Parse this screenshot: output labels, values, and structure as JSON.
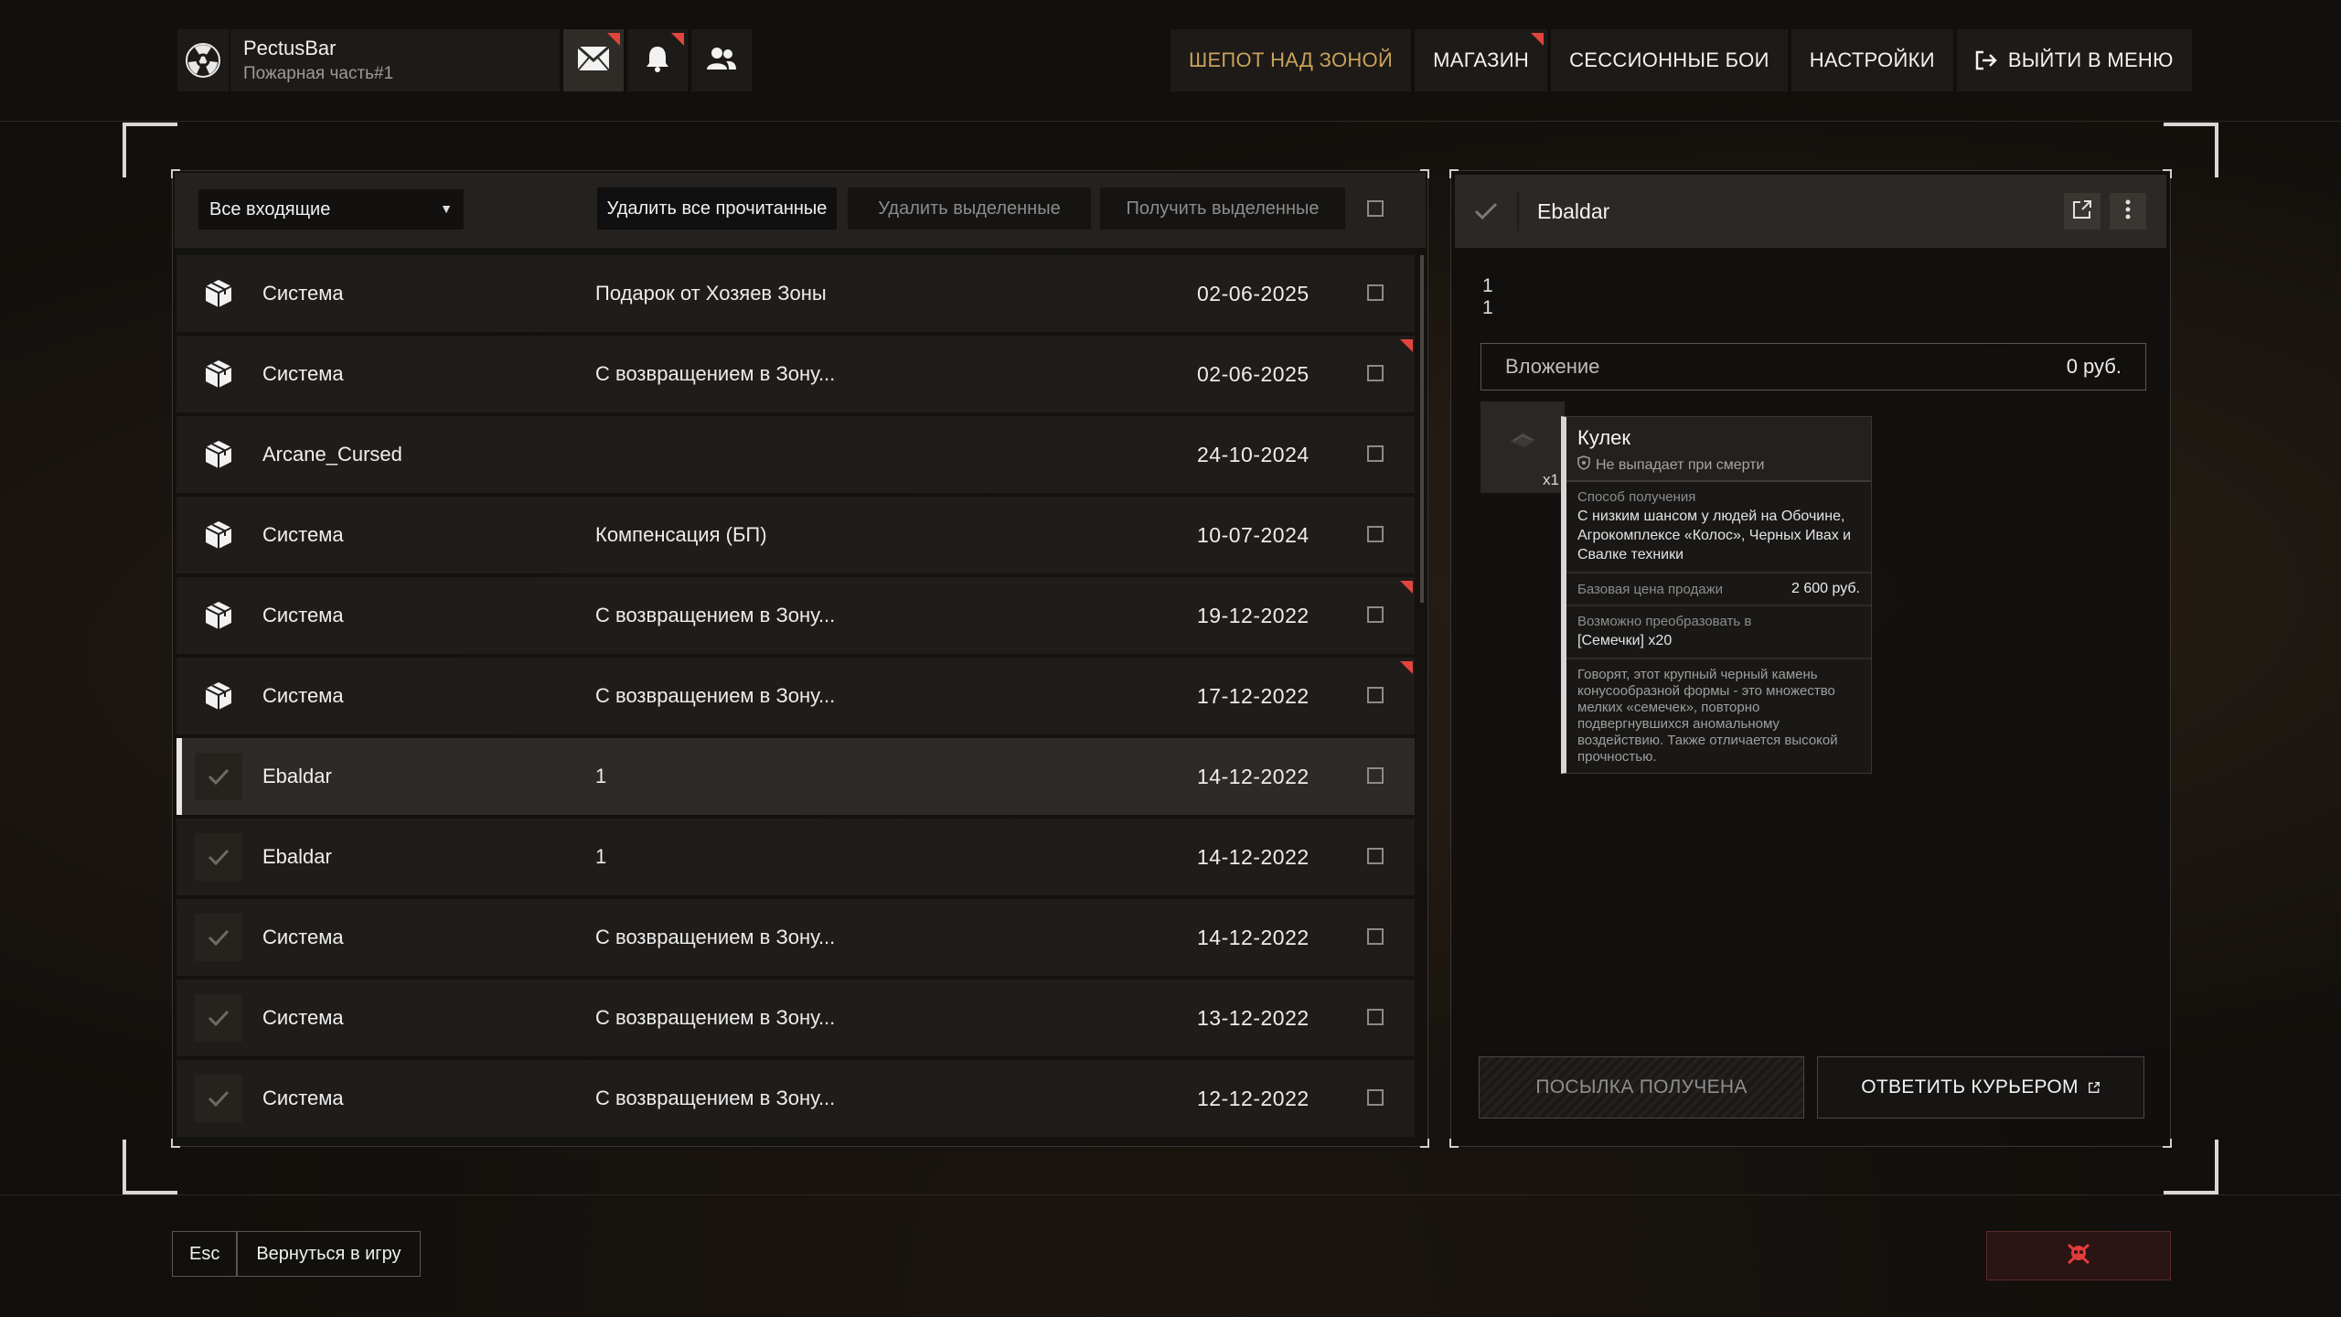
{
  "profile": {
    "nickname": "PectusBar",
    "subtitle": "Пожарная часть#1"
  },
  "top_icons": [
    {
      "name": "mail-icon",
      "badge": true,
      "active": true
    },
    {
      "name": "bell-icon",
      "badge": true,
      "active": false
    },
    {
      "name": "friends-icon",
      "badge": false,
      "active": false
    }
  ],
  "nav": {
    "whisper": "ШЕПОТ НАД ЗОНОЙ",
    "shop": "МАГАЗИН",
    "session": "СЕССИОННЫЕ БОИ",
    "settings": "НАСТРОЙКИ",
    "exit": "ВЫЙТИ В МЕНЮ"
  },
  "toolbar": {
    "filter_value": "Все входящие",
    "delete_read": "Удалить все прочитанные",
    "delete_selected": "Удалить выделенные",
    "get_selected": "Получить выделенные"
  },
  "messages": [
    {
      "sender": "Система",
      "subject": "Подарок от Хозяев Зоны",
      "date": "02-06-2025",
      "read": false,
      "new": false,
      "selected": false
    },
    {
      "sender": "Система",
      "subject": "С возвращением в Зону...",
      "date": "02-06-2025",
      "read": false,
      "new": true,
      "selected": false
    },
    {
      "sender": "Arcane_Cursed",
      "subject": "",
      "date": "24-10-2024",
      "read": false,
      "new": false,
      "selected": false
    },
    {
      "sender": "Система",
      "subject": "Компенсация (БП)",
      "date": "10-07-2024",
      "read": false,
      "new": false,
      "selected": false
    },
    {
      "sender": "Система",
      "subject": "С возвращением в Зону...",
      "date": "19-12-2022",
      "read": false,
      "new": true,
      "selected": false
    },
    {
      "sender": "Система",
      "subject": "С возвращением в Зону...",
      "date": "17-12-2022",
      "read": false,
      "new": true,
      "selected": false
    },
    {
      "sender": "Ebaldar",
      "subject": "1",
      "date": "14-12-2022",
      "read": true,
      "new": false,
      "selected": true
    },
    {
      "sender": "Ebaldar",
      "subject": "1",
      "date": "14-12-2022",
      "read": true,
      "new": false,
      "selected": false
    },
    {
      "sender": "Система",
      "subject": "С возвращением в Зону...",
      "date": "14-12-2022",
      "read": true,
      "new": false,
      "selected": false
    },
    {
      "sender": "Система",
      "subject": "С возвращением в Зону...",
      "date": "13-12-2022",
      "read": true,
      "new": false,
      "selected": false
    },
    {
      "sender": "Система",
      "subject": "С возвращением в Зону...",
      "date": "12-12-2022",
      "read": true,
      "new": false,
      "selected": false
    }
  ],
  "detail": {
    "title": "Ebaldar",
    "body_lines": [
      "1",
      "1"
    ],
    "attachment_label": "Вложение",
    "attachment_value": "0 руб.",
    "item_qty": "x1",
    "tooltip": {
      "name": "Кулек",
      "no_drop": "Не выпадает при смерти",
      "obtain_caption": "Способ получения",
      "obtain_text": "С низким шансом у людей на Обочине, Агрокомплексе «Колос», Черных Ивах и Свалке техники",
      "price_caption": "Базовая цена продажи",
      "price_value": "2 600 руб.",
      "convert_caption": "Возможно преобразовать в",
      "convert_value": "[Семечки] x20",
      "lore": "Говорят, этот крупный черный камень конусообразной формы - это множество мелких «семечек», повторно подвергнувшихся аномальному воздействию. Также отличается высокой прочностью."
    },
    "received_button": "ПОСЫЛКА ПОЛУЧЕНА",
    "reply_button": "ОТВЕТИТЬ КУРЬЕРОМ"
  },
  "bottom": {
    "esc_key": "Esc",
    "esc_label": "Вернуться в игру"
  },
  "colors": {
    "accent_gold": "#c9a259",
    "badge_red": "#e0463d",
    "danger": "#e23b3b"
  }
}
